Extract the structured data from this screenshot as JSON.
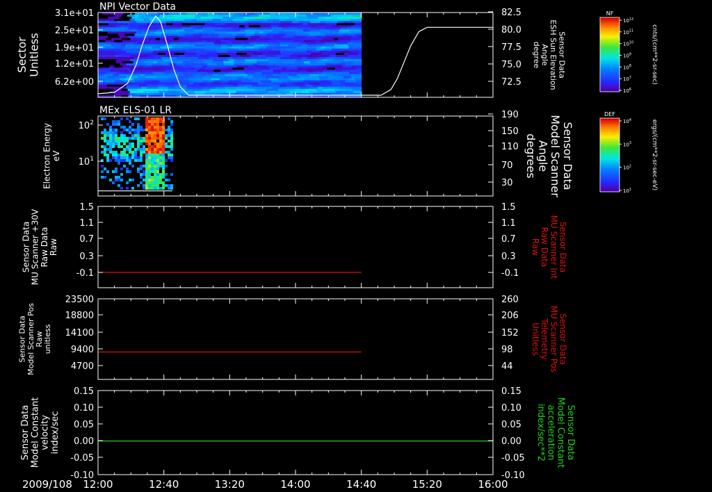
{
  "colors": {
    "background": "#000000",
    "axis": "#ffffff",
    "red_trace": "#e01010",
    "green_trace": "#20d020"
  },
  "x_axis": {
    "date_label": "2009/108",
    "tick_labels": [
      "12:00",
      "12:40",
      "13:20",
      "14:00",
      "14:40",
      "15:20",
      "16:00"
    ],
    "range": [
      "12:00",
      "16:00"
    ]
  },
  "chart_data": [
    {
      "type": "heatmap",
      "title": "NPI Vector Data",
      "ylabel_left": [
        "Sector",
        "Unitless"
      ],
      "ylabel_right": [
        "Sensor Data",
        "ESH Sun Elevation",
        "Angle",
        "degree"
      ],
      "y_ticks_left": [
        "3.1e+01",
        "2.5e+01",
        "1.9e+01",
        "1.2e+01",
        "6.2e+00"
      ],
      "y_ticks_right": [
        "82.5",
        "80.0",
        "77.5",
        "75.0",
        "72.5"
      ],
      "heatmap_extent": [
        "12:00",
        "14:40"
      ],
      "overlay_line": {
        "name": "ESH Sun Elevation Angle",
        "ylim": [
          70.5,
          82.5
        ],
        "points": [
          [
            "12:00",
            71.0
          ],
          [
            "12:10",
            71.2
          ],
          [
            "12:18",
            72.5
          ],
          [
            "12:23",
            75.0
          ],
          [
            "12:27",
            78.0
          ],
          [
            "12:31",
            80.5
          ],
          [
            "12:35",
            82.0
          ],
          [
            "12:38",
            81.2
          ],
          [
            "12:42",
            78.0
          ],
          [
            "12:46",
            74.5
          ],
          [
            "12:50",
            72.0
          ],
          [
            "12:55",
            70.8
          ],
          [
            "13:20",
            70.8
          ],
          [
            "14:00",
            70.8
          ],
          [
            "14:52",
            70.8
          ],
          [
            "14:58",
            71.6
          ],
          [
            "15:02",
            73.2
          ],
          [
            "15:06",
            75.5
          ],
          [
            "15:10",
            77.8
          ],
          [
            "15:15",
            79.8
          ],
          [
            "15:20",
            80.4
          ],
          [
            "16:00",
            80.4
          ]
        ]
      },
      "colorbar": {
        "label": "NF",
        "tick_labels": [
          "10^12",
          "10^11",
          "10^10",
          "10^9",
          "10^8",
          "10^7",
          "10^6"
        ],
        "units": "cnts/(cm**2-sr-sec)"
      }
    },
    {
      "type": "heatmap",
      "title": "MEx ELS-01 LR",
      "ylabel_left": [
        "Electron Energy",
        "eV"
      ],
      "ylabel_right": [
        "Sensor Data",
        "Model Scanner",
        "Angle",
        "degrees"
      ],
      "y_ticks_left": [
        "10^2",
        "10^1"
      ],
      "y_ticks_right": [
        "190",
        "150",
        "110",
        "70",
        "30"
      ],
      "heatmap_extent": [
        "12:00",
        "12:45"
      ],
      "overlay_line": {
        "name": "Model Scanner Angle",
        "ylim": [
          0,
          190
        ],
        "points": [
          [
            "12:00",
            12
          ],
          [
            "12:45",
            12
          ]
        ]
      },
      "colorbar": {
        "label": "DEF",
        "tick_labels": [
          "10^4",
          "10^3",
          "10^2",
          "10^1"
        ],
        "units": "ergs/(cm**2-sr-sec-eV)"
      }
    },
    {
      "type": "line",
      "ylabel_left": [
        "Sensor Data",
        "MU Scanner +30V",
        "Raw Data",
        "Raw"
      ],
      "ylabel_right": [
        "Sensor Data",
        "MU Scanner Int",
        "Raw Data",
        "Raw"
      ],
      "y_ticks_left": [
        "1.5",
        "1.1",
        "0.7",
        "0.3",
        "-0.1"
      ],
      "y_ticks_right": [
        "1.5",
        "1.1",
        "0.7",
        "0.3",
        "-0.1"
      ],
      "ylim": [
        -0.35,
        1.5
      ],
      "series": [
        {
          "color": "#e01010",
          "x": [
            "12:00",
            "14:40"
          ],
          "y": [
            0.0,
            0.0
          ]
        }
      ]
    },
    {
      "type": "line",
      "ylabel_left": [
        "Sensor Data",
        "Model Scanner Pos",
        "Raw",
        "unitless"
      ],
      "ylabel_right": [
        "Sensor Data",
        "MU Scanner Pos",
        "Telemetry",
        "Unitless"
      ],
      "y_ticks_left": [
        "23500",
        "18800",
        "14100",
        "9400",
        "4700"
      ],
      "y_ticks_right": [
        "260",
        "206",
        "152",
        "98",
        "44"
      ],
      "ylim": [
        0,
        23500
      ],
      "series": [
        {
          "color": "#e01010",
          "x": [
            "12:00",
            "14:40"
          ],
          "y": [
            8000,
            8000
          ]
        }
      ]
    },
    {
      "type": "line",
      "ylabel_left": [
        "Sensor Data",
        "Model Constant",
        "velocity",
        "index/sec"
      ],
      "ylabel_right": [
        "Sensor Data",
        "Model Constant",
        "acceleration",
        "index/sec**2"
      ],
      "y_ticks_left": [
        "0.15",
        "0.10",
        "0.05",
        "0.00",
        "-0.05",
        "-0.10"
      ],
      "y_ticks_right": [
        "0.15",
        "0.10",
        "0.05",
        "0.00",
        "-0.05",
        "-0.10"
      ],
      "ylim": [
        -0.1,
        0.15
      ],
      "series": [
        {
          "color": "#20d020",
          "x": [
            "12:00",
            "16:00"
          ],
          "y": [
            0.0,
            0.0
          ]
        }
      ]
    }
  ]
}
